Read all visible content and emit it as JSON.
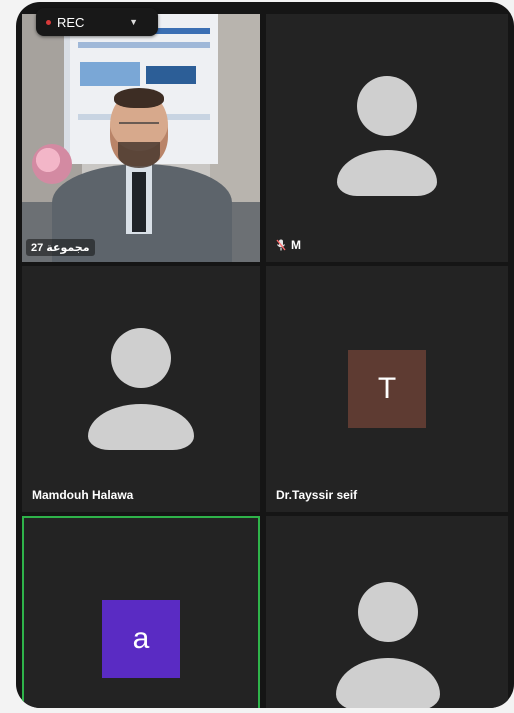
{
  "recording": {
    "label": "REC"
  },
  "tiles": [
    {
      "name": "مجموعة 27"
    },
    {
      "name": "M"
    },
    {
      "name": "Mamdouh Halawa"
    },
    {
      "name": "Dr.Tayssir seif",
      "initial": "T",
      "color": "#5e3b32"
    },
    {
      "name": "",
      "initial": "a",
      "color": "#5a2bc3"
    },
    {
      "name": ""
    }
  ]
}
